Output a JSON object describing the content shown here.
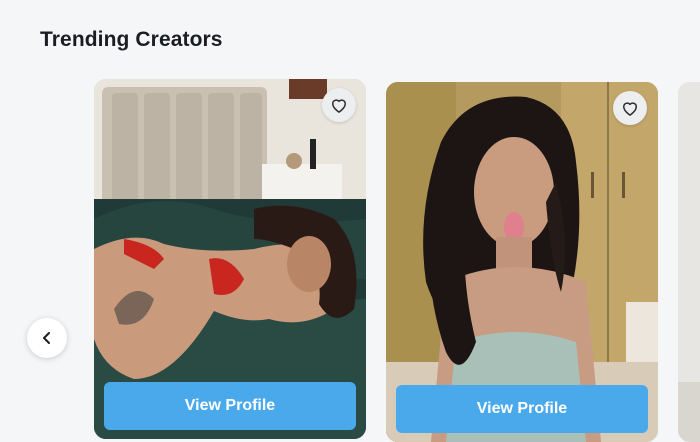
{
  "section": {
    "title": "Trending Creators"
  },
  "carousel": {
    "prev_icon": "chevron-left-icon",
    "cards": [
      {
        "favorite_icon": "heart-outline-icon",
        "button_label": "View Profile"
      },
      {
        "favorite_icon": "heart-outline-icon",
        "button_label": "View Profile"
      }
    ]
  },
  "colors": {
    "accent": "#4aa9ea",
    "background": "#f5f6f8",
    "title": "#1a1d21"
  }
}
